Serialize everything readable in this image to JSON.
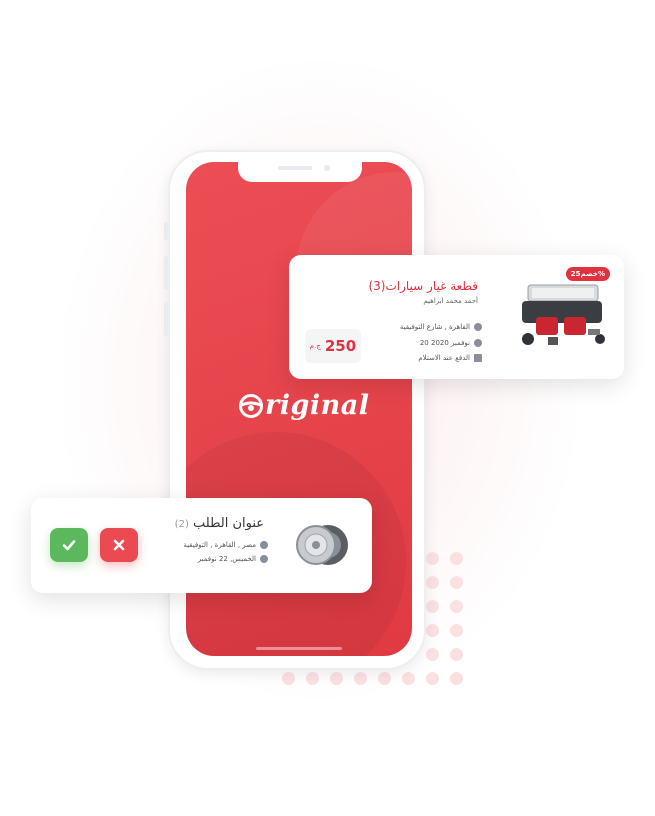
{
  "brand": {
    "logo_text": "riginal",
    "accent": "#e0333d"
  },
  "product_card": {
    "discount_badge": "خصم25%",
    "title": "قطعة غيار سيارات(3)",
    "seller": "أحمد محمد ابراهيم",
    "location": "القاهرة , شارع التوفيقية",
    "date": "نوفمبر 2020 20",
    "payment": "الدفع عند الاستلام",
    "price": "250",
    "currency": "ج.م"
  },
  "order_card": {
    "title": "عنوان الطلب",
    "count": "(2)",
    "location": "مصر , القاهرة , التوفيقية",
    "date": "الخميس, 22 نوفمبر",
    "accept_icon": "check-icon",
    "reject_icon": "close-icon"
  }
}
